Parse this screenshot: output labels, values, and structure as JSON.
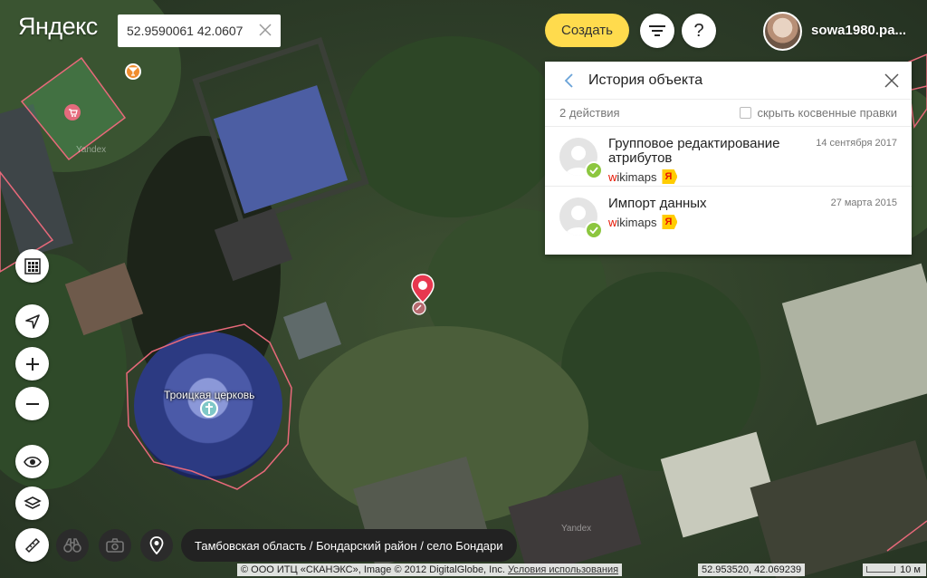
{
  "app": {
    "logo": "Яндекс"
  },
  "search": {
    "value": "52.9590061 42.0607"
  },
  "header": {
    "create_label": "Создать",
    "help_label": "?",
    "username": "sowa1980.pa..."
  },
  "history_panel": {
    "title": "История объекта",
    "actions_count": "2 действия",
    "hide_indirect_label": "скрыть косвенные правки",
    "items": [
      {
        "action": "Групповое редактирование атрибутов",
        "date": "14 сентября 2017",
        "source_w": "w",
        "source_rest": "ikimaps",
        "badge": "Я"
      },
      {
        "action": "Импорт данных",
        "date": "27 марта 2015",
        "source_w": "w",
        "source_rest": "ikimaps",
        "badge": "Я"
      }
    ]
  },
  "map": {
    "church_label": "Троицкая церковь",
    "watermark": "Yandex"
  },
  "breadcrumb": "Тамбовская область / Бондарский район / село Бондари",
  "footer": {
    "copyright": "© ООО ИТЦ «СКАНЭКС», Image © 2012 DigitalGlobe, Inc.",
    "terms": "Условия использования",
    "coordinates": "52.953520, 42.069239",
    "scale": "10 м"
  }
}
